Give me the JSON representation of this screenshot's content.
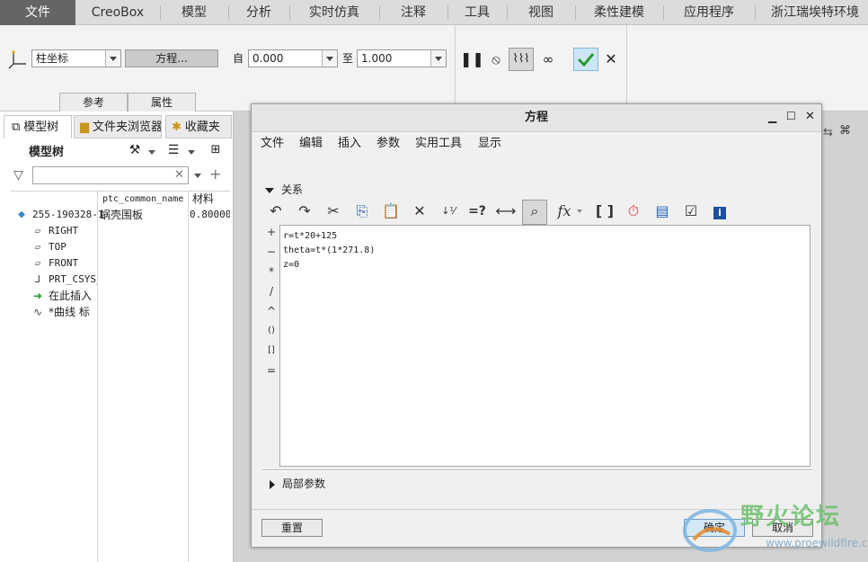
{
  "menubar": {
    "tabs": [
      "文件",
      "CreoBox",
      "模型",
      "分析",
      "实时仿真",
      "注释",
      "工具",
      "视图",
      "柔性建模",
      "应用程序",
      "浙江瑞埃特环境"
    ]
  },
  "ribbon": {
    "coord_type": "柱坐标",
    "equation_button": "方程...",
    "from_label": "自",
    "from_value": "0.000",
    "to_label": "至",
    "to_value": "1.000",
    "subtabs": [
      "参考",
      "属性"
    ]
  },
  "left_panel": {
    "tabs": [
      "模型树",
      "文件夹浏览器",
      "收藏夹"
    ],
    "tree_title": "模型树",
    "columns": [
      "ptc_common_name",
      "材料"
    ],
    "rows": [
      {
        "name": "255-190328-1",
        "common_name": "蜗壳围板",
        "material": "0.80000"
      },
      {
        "name": "RIGHT"
      },
      {
        "name": "TOP"
      },
      {
        "name": "FRONT"
      },
      {
        "name": "PRT_CSYS_"
      },
      {
        "name": "在此插入"
      },
      {
        "name": "*曲线 标"
      }
    ]
  },
  "dialog": {
    "title": "方程",
    "menu": [
      "文件",
      "编辑",
      "插入",
      "参数",
      "实用工具",
      "显示"
    ],
    "section_relations": "关系",
    "side_ops": [
      "+",
      "−",
      "*",
      "/",
      "^",
      "()",
      "[]",
      "="
    ],
    "code_lines": [
      "r=t*20+125",
      "theta=t*(1*271.8)",
      "z=0"
    ],
    "section_local_params": "局部参数",
    "reset_button": "重置",
    "ok_button": "确定",
    "cancel_button": "取消"
  },
  "watermark": {
    "text": "野火论坛",
    "url": "www.proewildfire.cn"
  }
}
